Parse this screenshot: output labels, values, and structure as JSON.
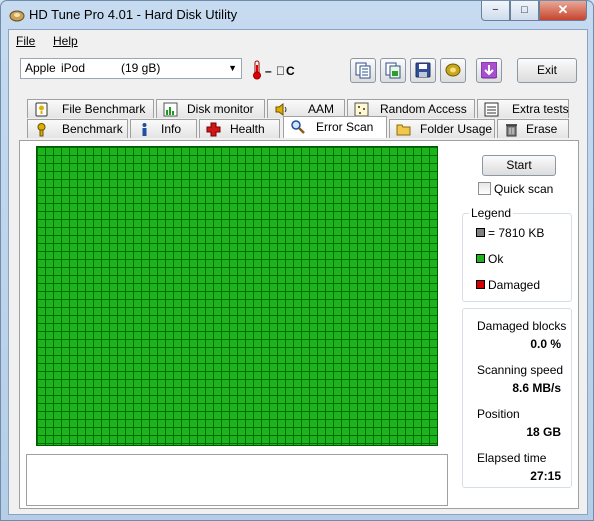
{
  "window": {
    "title": "HD Tune Pro 4.01 - Hard Disk Utility"
  },
  "caption_buttons": {
    "minimize": "−",
    "maximize": "□",
    "close": "✕"
  },
  "menu": {
    "file": "File",
    "help": "Help"
  },
  "drive": {
    "vendor": "Apple",
    "model": "iPod",
    "size": "(19 gB)"
  },
  "temperature": {
    "text": "– ﾟC"
  },
  "toolbar": {
    "buttons": [
      "copy-text-icon",
      "copy-image-icon",
      "save-icon",
      "options-icon",
      "download-icon"
    ],
    "exit_label": "Exit"
  },
  "tabs": {
    "row1": [
      "File Benchmark",
      "Disk monitor",
      "AAM",
      "Random Access",
      "Extra tests"
    ],
    "row2": [
      "Benchmark",
      "Info",
      "Health",
      "Error Scan",
      "Folder Usage",
      "Erase"
    ],
    "active": "Error Scan"
  },
  "scan": {
    "start_label": "Start",
    "quick_scan_label": "Quick scan",
    "quick_scan_checked": false,
    "legend": {
      "title": "Legend",
      "block_size": "= 7810 KB",
      "ok": "Ok",
      "damaged": "Damaged",
      "colors": {
        "block": "#808080",
        "ok": "#1db31d",
        "damaged": "#d40000"
      }
    },
    "stats": {
      "damaged_blocks_label": "Damaged blocks",
      "damaged_blocks_value": "0.0 %",
      "scanning_speed_label": "Scanning speed",
      "scanning_speed_value": "8.6 MB/s",
      "position_label": "Position",
      "position_value": "18 GB",
      "elapsed_label": "Elapsed time",
      "elapsed_value": "27:15"
    }
  }
}
